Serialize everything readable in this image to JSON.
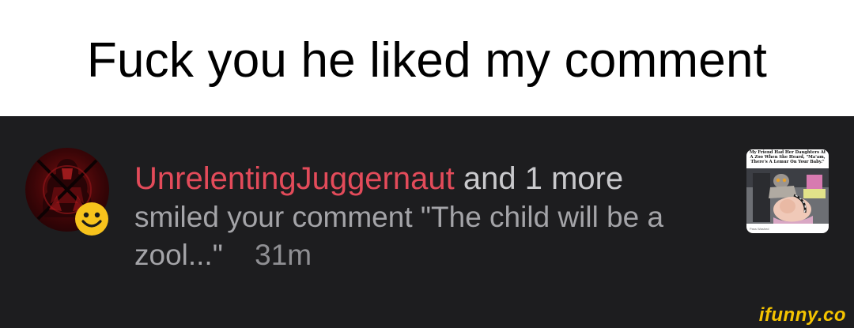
{
  "meme": {
    "caption": "Fuck you he liked my comment"
  },
  "notification": {
    "avatar_icon": "dark-red-avatar-icon",
    "reaction_icon": "smiley-face-icon",
    "username": "UnrelentingJuggernaut",
    "and_more": "and 1 more",
    "message_line1": "smiled your comment \"The child will be a",
    "message_line2": "zool...\"",
    "time": "31m",
    "colors": {
      "username": "#e34b5a",
      "background": "#1d1d1f",
      "reaction": "#f7c31c"
    },
    "thumbnail": {
      "caption": "My Friend Had Her Daughters At A Zoo When She Heard, \"Ma'am, There's A Lemur On Your Baby.\"",
      "footer": "Pass Washed"
    }
  },
  "watermark": "ifunny.co"
}
